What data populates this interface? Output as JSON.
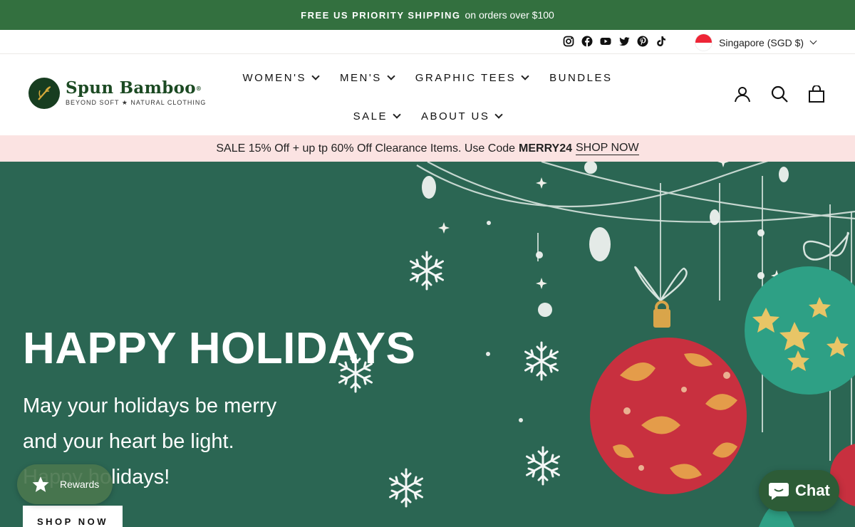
{
  "announcement": {
    "bold": "FREE US PRIORITY SHIPPING",
    "text": "on orders over $100"
  },
  "utility": {
    "socials": [
      "instagram-icon",
      "facebook-icon",
      "youtube-icon",
      "twitter-icon",
      "pinterest-icon",
      "tiktok-icon"
    ],
    "locale": "Singapore (SGD $)"
  },
  "logo": {
    "name": "Spun Bamboo",
    "tagline": "BEYOND SOFT ★ NATURAL CLOTHING"
  },
  "nav": {
    "womens": "WOMEN'S",
    "mens": "MEN'S",
    "graphic_tees": "GRAPHIC TEES",
    "bundles": "BUNDLES",
    "sale": "SALE",
    "about": "ABOUT US"
  },
  "header_icons": [
    "account-icon",
    "search-icon",
    "cart-icon"
  ],
  "promo": {
    "text": "SALE 15% Off + up tp 60% Off Clearance Items. Use Code",
    "code": "MERRY24",
    "link": "SHOP NOW"
  },
  "hero": {
    "title": "HAPPY HOLIDAYS",
    "line1": "May your holidays be merry",
    "line2": "and your heart be light.",
    "line3": "Happy holidays!",
    "button": "SHOP NOW"
  },
  "rewards": {
    "label": "Rewards"
  },
  "chat": {
    "label": "Chat"
  },
  "colors": {
    "brand_green": "#33703f",
    "hero_bg": "#2a6552",
    "promo_bg": "#fbe3e2",
    "ornament_red": "#c8303f",
    "ornament_teal": "#2ea085",
    "gold": "#d9a54a"
  }
}
